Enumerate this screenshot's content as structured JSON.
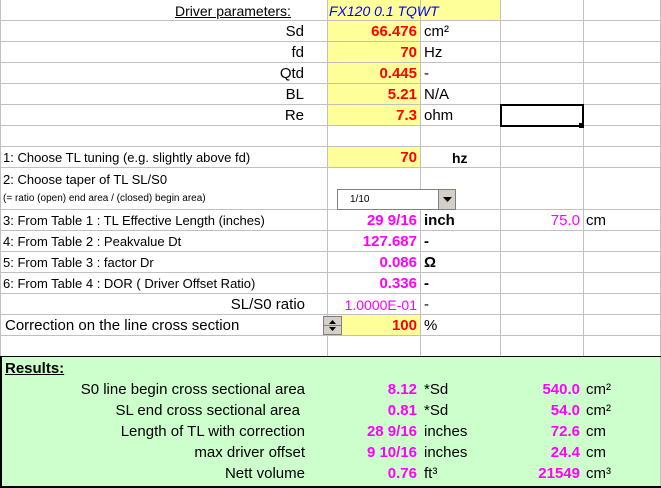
{
  "driver": {
    "heading": "Driver parameters:",
    "model": "FX120 0.1 TQWT",
    "params": [
      {
        "label": "Sd",
        "value": "66.476",
        "unit": "cm²"
      },
      {
        "label": "fd",
        "value": "70",
        "unit": "Hz"
      },
      {
        "label": "Qtd",
        "value": "0.445",
        "unit": "-"
      },
      {
        "label": "BL",
        "value": "5.21",
        "unit": "N/A"
      },
      {
        "label": "Re",
        "value": "7.3",
        "unit": "ohm"
      }
    ]
  },
  "steps": {
    "s1_label": "1: Choose TL tuning (e.g. slightly above fd)",
    "s1_value": "70",
    "s1_unit": "hz",
    "s2_label": "2: Choose taper of TL SL/S0",
    "s2_note": "(= ratio (open) end area / (closed) begin area)",
    "taper_selected": "1/10",
    "s3_label": "3: From Table 1 : TL Effective Length (inches)",
    "s3_value": "29  9/16",
    "s3_unit": "inch",
    "s3_cm": "75.0",
    "s3_cm_unit": "cm",
    "s4_label": "4: From Table 2 : Peakvalue Dt",
    "s4_value": "127.687",
    "s4_unit": "-",
    "s5_label": "5: From Table 3 : factor Dr",
    "s5_value": "0.086",
    "s5_unit": "Ω",
    "s6_label": "6: From Table 4 : DOR ( Driver Offset Ratio)",
    "s6_value": "0.336",
    "s6_unit": "-",
    "ratio_label": "SL/S0 ratio",
    "ratio_value": "1.0000E-01",
    "ratio_unit": "-",
    "corr_label": "Correction on the line cross section",
    "corr_value": "100",
    "corr_unit": "%"
  },
  "results": {
    "heading": "Results:",
    "rows": [
      {
        "label": "S0 line begin cross sectional area",
        "v1": "8.12",
        "u1": "*Sd",
        "v2": "540.0",
        "u2": "cm²"
      },
      {
        "label": "SL end cross sectional area",
        "v1": "0.81",
        "u1": "*Sd",
        "v2": "54.0",
        "u2": "cm²"
      },
      {
        "label": "Length of TL with correction",
        "v1": "28 9/16",
        "u1": "inches",
        "v2": "72.6",
        "u2": "cm"
      },
      {
        "label": "max driver offset",
        "v1": "9 10/16",
        "u1": "inches",
        "v2": "24.4",
        "u2": "cm"
      },
      {
        "label": "Nett volume",
        "v1": "0.76",
        "u1": "ft³",
        "v2": "21549",
        "u2": "cm³"
      }
    ]
  }
}
